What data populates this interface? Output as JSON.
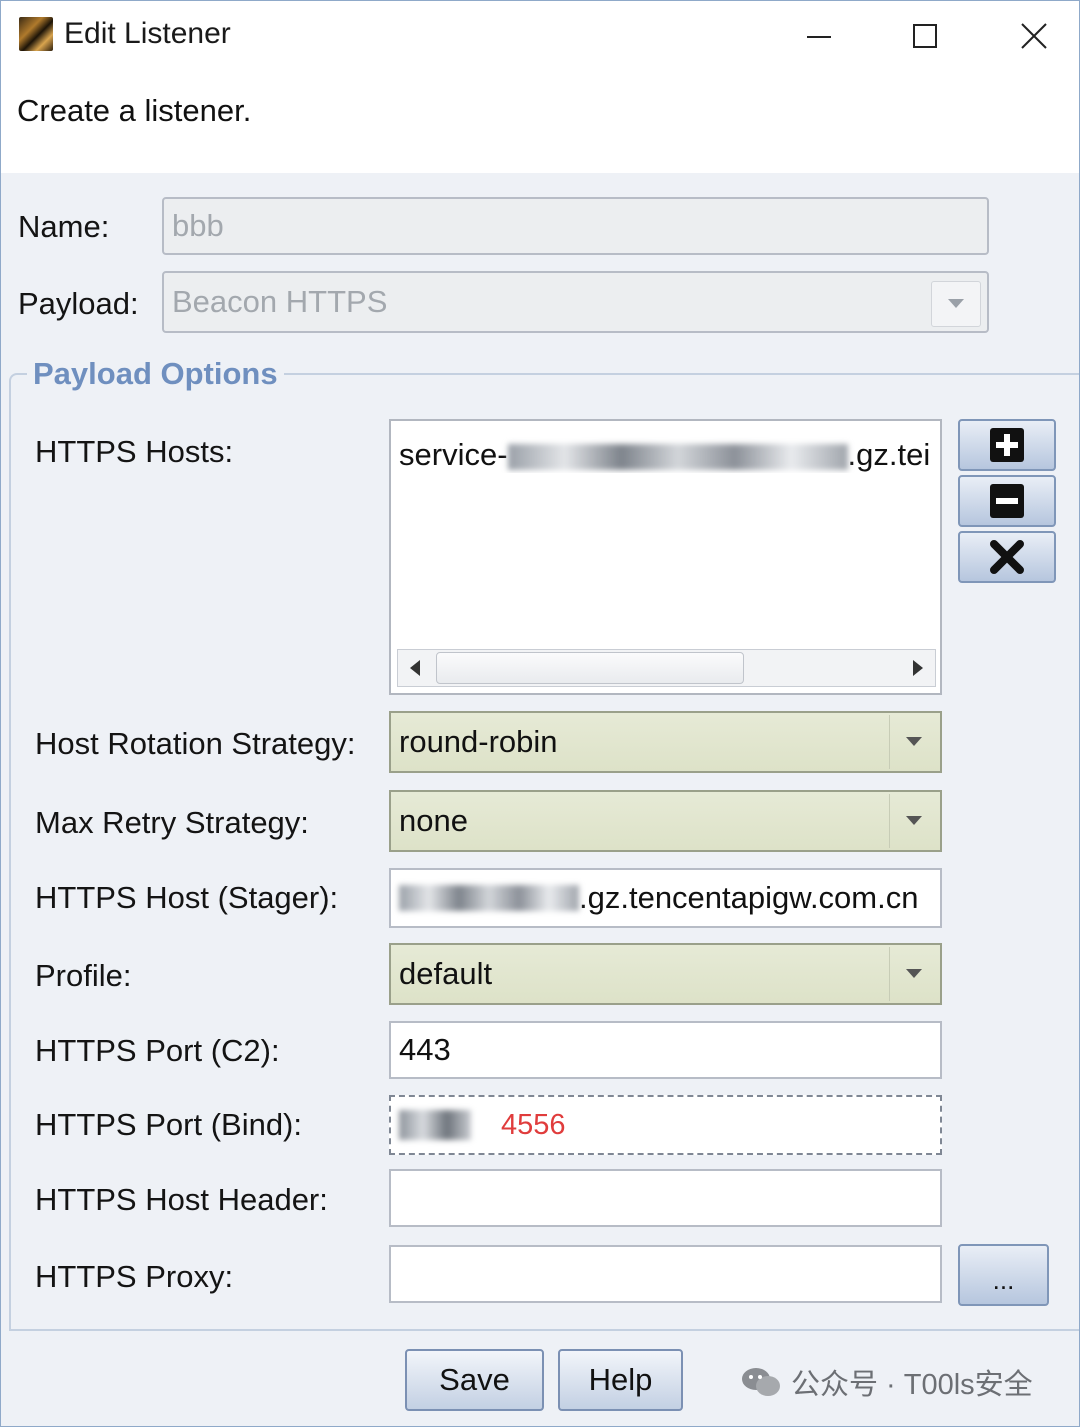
{
  "window": {
    "title": "Edit Listener",
    "controls": [
      "minimize",
      "maximize",
      "close"
    ]
  },
  "description": "Create a listener.",
  "name": {
    "label": "Name:",
    "value": "bbb"
  },
  "payload": {
    "label": "Payload:",
    "value": "Beacon HTTPS"
  },
  "payload_options": {
    "title": "Payload Options",
    "https_hosts": {
      "label": "HTTPS Hosts:",
      "items": [
        {
          "prefix": "service-",
          "suffix": ".gz.tei"
        }
      ]
    },
    "host_rotation": {
      "label": "Host Rotation Strategy:",
      "value": "round-robin"
    },
    "max_retry": {
      "label": "Max Retry Strategy:",
      "value": "none"
    },
    "https_host_stager": {
      "label": "HTTPS Host (Stager):",
      "suffix": ".gz.tencentapigw.com.cn"
    },
    "profile": {
      "label": "Profile:",
      "value": "default"
    },
    "https_port_c2": {
      "label": "HTTPS Port (C2):",
      "value": "443"
    },
    "https_port_bind": {
      "label": "HTTPS Port (Bind):",
      "annotation": "4556"
    },
    "https_host_header": {
      "label": "HTTPS Host Header:",
      "value": ""
    },
    "https_proxy": {
      "label": "HTTPS Proxy:",
      "value": "",
      "button": "..."
    }
  },
  "buttons": {
    "save": "Save",
    "help": "Help"
  },
  "watermark": {
    "text": "公众号 · T00ls安全"
  },
  "colors": {
    "group_title": "#6f8fbf",
    "combo_bg": "#e1e5cf",
    "annotation": "#e03c3c"
  }
}
